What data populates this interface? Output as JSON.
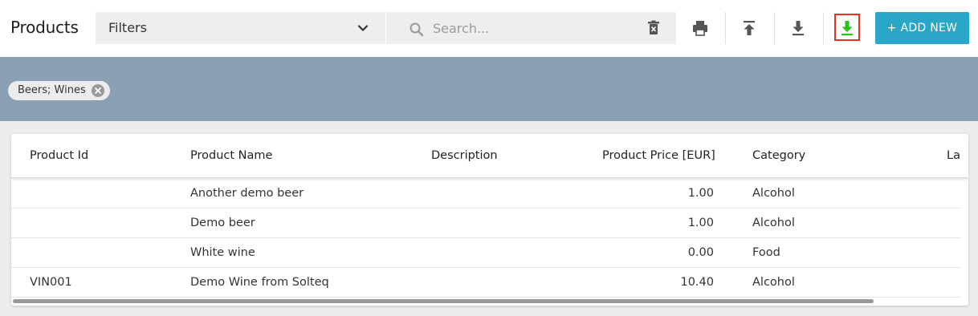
{
  "header": {
    "title": "Products",
    "filters_label": "Filters",
    "search_placeholder": "Search...",
    "add_new_label": "+ ADD NEW",
    "accent_color": "#2aa7c7",
    "highlight_color": "#e53222",
    "toolbar_icons": [
      "print-icon",
      "upload-icon",
      "download-icon",
      "download-green-icon"
    ]
  },
  "filter_chips": [
    {
      "label": "Beers; Wines"
    }
  ],
  "table": {
    "columns": [
      "Product Id",
      "Product Name",
      "Description",
      "Product Price [EUR]",
      "Category",
      "La"
    ],
    "rows": [
      {
        "id": "",
        "name": "Another demo beer",
        "description": "",
        "price": "1.00",
        "category": "Alcohol"
      },
      {
        "id": "",
        "name": "Demo beer",
        "description": "",
        "price": "1.00",
        "category": "Alcohol"
      },
      {
        "id": "",
        "name": "White wine",
        "description": "",
        "price": "0.00",
        "category": "Food"
      },
      {
        "id": "VIN001",
        "name": "Demo Wine from Solteq",
        "description": "",
        "price": "10.40",
        "category": "Alcohol"
      }
    ]
  }
}
